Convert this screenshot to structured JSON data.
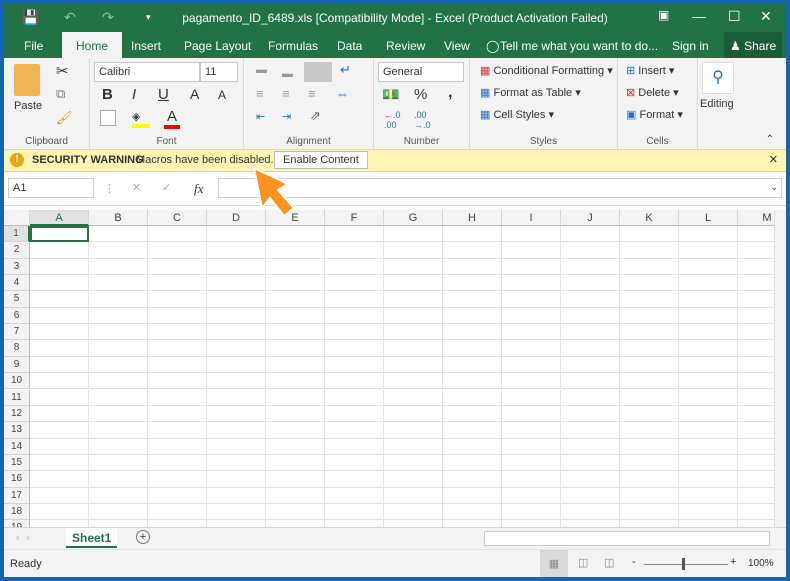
{
  "title": "pagamento_ID_6489.xls  [Compatibility Mode] - Excel (Product Activation Failed)",
  "tabs": [
    "File",
    "Home",
    "Insert",
    "Page Layout",
    "Formulas",
    "Data",
    "Review",
    "View"
  ],
  "tell_me": "Tell me what you want to do...",
  "sign_in": "Sign in",
  "share": "Share",
  "ribbon": {
    "clipboard": {
      "label": "Clipboard",
      "paste": "Paste"
    },
    "font": {
      "label": "Font",
      "name": "Calibri",
      "size": "11",
      "bold": "B",
      "italic": "I",
      "underline": "U",
      "grow": "A",
      "shrink": "A",
      "color": "A"
    },
    "alignment": {
      "label": "Alignment"
    },
    "number": {
      "label": "Number",
      "format": "General",
      "percent": "%",
      "comma": ","
    },
    "styles": {
      "label": "Styles",
      "items": [
        "Conditional Formatting",
        "Format as Table",
        "Cell Styles"
      ]
    },
    "cells": {
      "label": "Cells",
      "items": [
        "Insert",
        "Delete",
        "Format"
      ]
    },
    "editing": {
      "label": "Editing"
    }
  },
  "security": {
    "title": "SECURITY WARNING",
    "message": "Macros have been disabled.",
    "button": "Enable Content"
  },
  "formula": {
    "name_box": "A1",
    "fx": "fx",
    "value": ""
  },
  "columns": [
    "A",
    "B",
    "C",
    "D",
    "E",
    "F",
    "G",
    "H",
    "I",
    "J",
    "K",
    "L",
    "M"
  ],
  "rows": [
    "1",
    "2",
    "3",
    "4",
    "5",
    "6",
    "7",
    "8",
    "9",
    "10",
    "11",
    "12",
    "13",
    "14",
    "15",
    "16",
    "17",
    "18",
    "19"
  ],
  "selected_cell": "A1",
  "sheets": [
    "Sheet1"
  ],
  "status": {
    "text": "Ready",
    "zoom": "100%",
    "zoom_minus": "-",
    "zoom_plus": "+"
  },
  "colors": {
    "brand": "#217346",
    "warning_bg": "#fff4b3",
    "arrow": "#f7931e"
  }
}
